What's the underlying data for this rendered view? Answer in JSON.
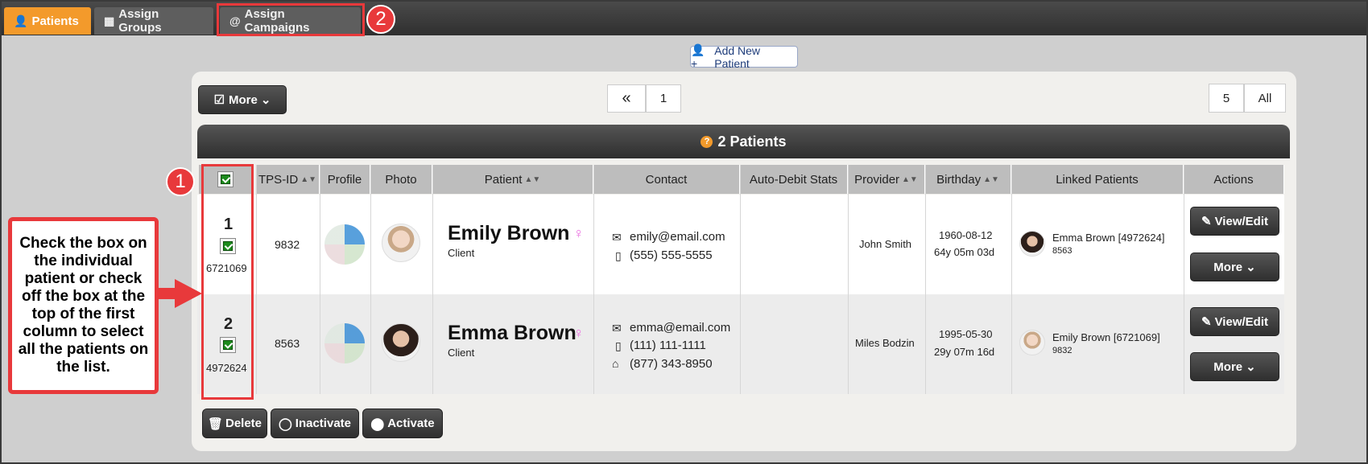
{
  "tabs": [
    {
      "label": "Patients",
      "icon": "user-icon"
    },
    {
      "label": "Assign Groups",
      "icon": "group-icon"
    },
    {
      "label": "Assign Campaigns",
      "icon": "at-icon"
    }
  ],
  "annotations": {
    "badge1": "1",
    "badge2": "2",
    "callout": "Check the box on the individual patient or check off the box at the top of the first column to select all the patients on the list."
  },
  "add_patient_label": "Add New Patient",
  "toolbar": {
    "more_label": "More",
    "page_first": "«",
    "page_current": "1",
    "page_size_5": "5",
    "page_size_all": "All"
  },
  "banner": {
    "title": "2 Patients"
  },
  "columns": [
    "TPS-ID",
    "Profile",
    "Photo",
    "Patient",
    "Contact",
    "Auto-Debit Stats",
    "Provider",
    "Birthday",
    "Linked Patients",
    "Actions"
  ],
  "rows": [
    {
      "index": "1",
      "id": "6721069",
      "tps_id": "9832",
      "name": "Emily Brown",
      "role": "Client",
      "contact": [
        "emily@email.com",
        "(555) 555-5555"
      ],
      "provider": "John Smith",
      "birthday": "1960-08-12",
      "age": "64y 05m 03d",
      "linked_name": "Emma Brown [4972624]",
      "linked_id": "8563"
    },
    {
      "index": "2",
      "id": "4972624",
      "tps_id": "8563",
      "name": "Emma Brown",
      "role": "Client",
      "contact": [
        "emma@email.com",
        "(111) 111-1111",
        "(877) 343-8950"
      ],
      "provider": "Miles Bodzin",
      "birthday": "1995-05-30",
      "age": "29y 07m 16d",
      "linked_name": "Emily Brown [6721069]",
      "linked_id": "9832"
    }
  ],
  "actions": {
    "view_edit": "View/Edit",
    "more": "More"
  },
  "bulk": {
    "delete": "Delete",
    "inactivate": "Inactivate",
    "activate": "Activate"
  },
  "colors": {
    "accent": "#f39a2b",
    "highlight": "#e8393b",
    "female": "#e96fe0"
  }
}
